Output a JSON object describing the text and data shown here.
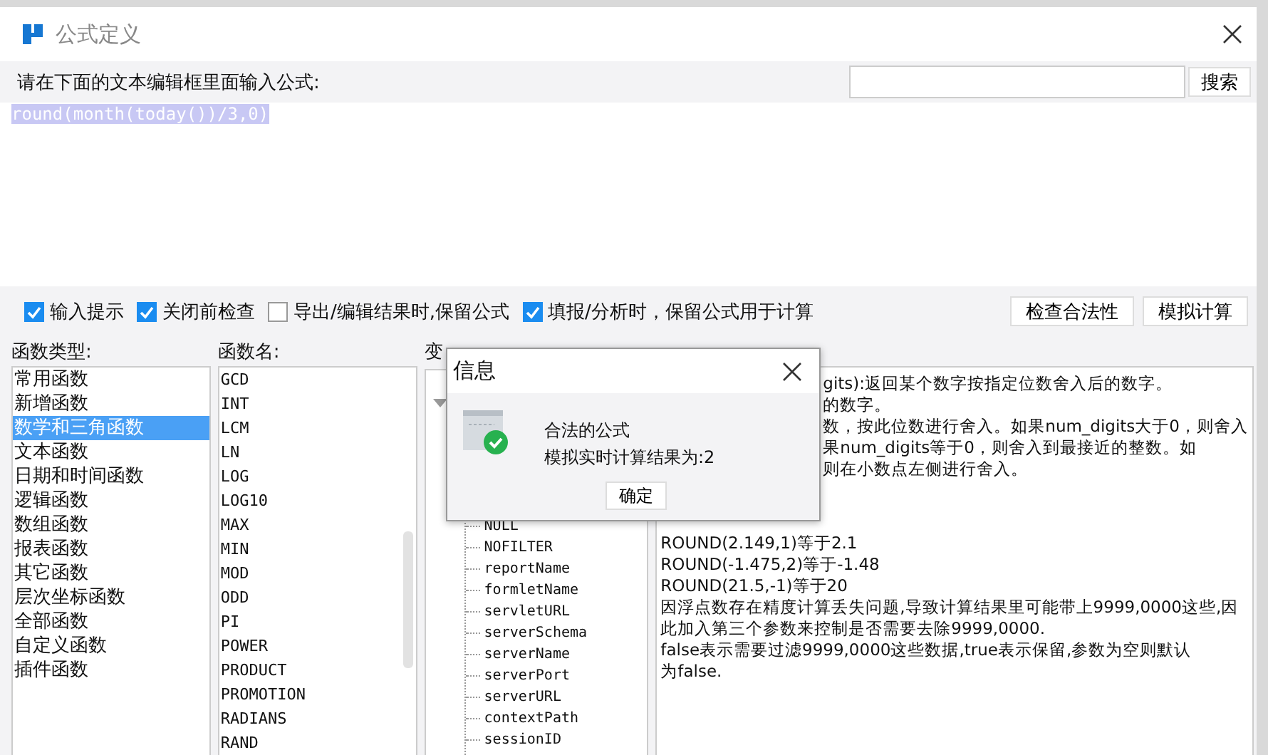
{
  "window": {
    "title": "公式定义"
  },
  "prompt": "请在下面的文本编辑框里面输入公式:",
  "search": {
    "button": "搜索"
  },
  "editor": {
    "value": "round(month(today())/3,0)",
    "selected": true
  },
  "options": [
    {
      "label": "输入提示",
      "checked": true
    },
    {
      "label": "关闭前检查",
      "checked": true
    },
    {
      "label": "导出/编辑结果时,保留公式",
      "checked": false
    },
    {
      "label": "填报/分析时，保留公式用于计算",
      "checked": true
    }
  ],
  "buttons": [
    "检查合法性",
    "模拟计算"
  ],
  "function_types": {
    "header": "函数类型:",
    "items": [
      {
        "label": "常用函数",
        "selected": false
      },
      {
        "label": "新增函数",
        "selected": false
      },
      {
        "label": "数学和三角函数",
        "selected": true
      },
      {
        "label": "文本函数",
        "selected": false
      },
      {
        "label": "日期和时间函数",
        "selected": false
      },
      {
        "label": "逻辑函数",
        "selected": false
      },
      {
        "label": "数组函数",
        "selected": false
      },
      {
        "label": "报表函数",
        "selected": false
      },
      {
        "label": "其它函数",
        "selected": false
      },
      {
        "label": "层次坐标函数",
        "selected": false
      },
      {
        "label": "全部函数",
        "selected": false
      },
      {
        "label": "自定义函数",
        "selected": false
      },
      {
        "label": "插件函数",
        "selected": false
      }
    ]
  },
  "function_names": {
    "header": "函数名:",
    "items": [
      {
        "label": "GCD",
        "selected": false
      },
      {
        "label": "INT",
        "selected": false
      },
      {
        "label": "LCM",
        "selected": false
      },
      {
        "label": "LN",
        "selected": false
      },
      {
        "label": "LOG",
        "selected": false
      },
      {
        "label": "LOG10",
        "selected": false
      },
      {
        "label": "MAX",
        "selected": false
      },
      {
        "label": "MIN",
        "selected": false
      },
      {
        "label": "MOD",
        "selected": false
      },
      {
        "label": "ODD",
        "selected": false
      },
      {
        "label": "PI",
        "selected": false
      },
      {
        "label": "POWER",
        "selected": false
      },
      {
        "label": "PRODUCT",
        "selected": false
      },
      {
        "label": "PROMOTION",
        "selected": false
      },
      {
        "label": "RADIANS",
        "selected": false
      },
      {
        "label": "RAND",
        "selected": false
      }
    ]
  },
  "variables": {
    "header": "变",
    "items": [
      "NULL",
      "NOFILTER",
      "reportName",
      "formletName",
      "servletURL",
      "serverSchema",
      "serverName",
      "serverPort",
      "serverURL",
      "contextPath",
      "sessionID"
    ]
  },
  "description": {
    "partial_lines": [
      "gits):返回某个数字按指定位数舍入后的数字。",
      "的数字。",
      "数，按此位数进行舍入。如果num_digits大于0，则舍入",
      "果num_digits等于0，则舍入到最接近的整数。如",
      "则在小数点左侧进行舍入。"
    ],
    "lines": [
      "ROUND(2.149,1)等于2.1",
      "ROUND(-1.475,2)等于-1.48",
      "ROUND(21.5,-1)等于20",
      "因浮点数存在精度计算丢失问题,导致计算结果里可能带上9999,0000这些,因",
      "此加入第三个参数来控制是否需要去除9999,0000.",
      "false表示需要过滤9999,0000这些数据,true表示保留,参数为空则默认",
      "为false."
    ]
  },
  "dialog": {
    "title": "信息",
    "messages": [
      "合法的公式",
      "模拟实时计算结果为:2"
    ],
    "button": "确定"
  }
}
